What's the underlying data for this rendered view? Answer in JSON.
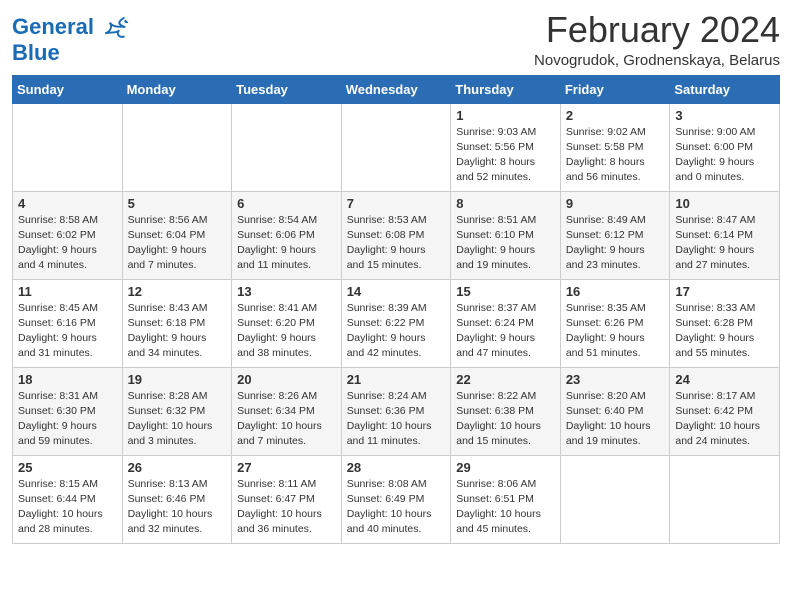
{
  "header": {
    "logo_line1": "General",
    "logo_line2": "Blue",
    "month_title": "February 2024",
    "subtitle": "Novogrudok, Grodnenskaya, Belarus"
  },
  "days_of_week": [
    "Sunday",
    "Monday",
    "Tuesday",
    "Wednesday",
    "Thursday",
    "Friday",
    "Saturday"
  ],
  "weeks": [
    [
      {
        "day": "",
        "info": ""
      },
      {
        "day": "",
        "info": ""
      },
      {
        "day": "",
        "info": ""
      },
      {
        "day": "",
        "info": ""
      },
      {
        "day": "1",
        "info": "Sunrise: 9:03 AM\nSunset: 5:56 PM\nDaylight: 8 hours\nand 52 minutes."
      },
      {
        "day": "2",
        "info": "Sunrise: 9:02 AM\nSunset: 5:58 PM\nDaylight: 8 hours\nand 56 minutes."
      },
      {
        "day": "3",
        "info": "Sunrise: 9:00 AM\nSunset: 6:00 PM\nDaylight: 9 hours\nand 0 minutes."
      }
    ],
    [
      {
        "day": "4",
        "info": "Sunrise: 8:58 AM\nSunset: 6:02 PM\nDaylight: 9 hours\nand 4 minutes."
      },
      {
        "day": "5",
        "info": "Sunrise: 8:56 AM\nSunset: 6:04 PM\nDaylight: 9 hours\nand 7 minutes."
      },
      {
        "day": "6",
        "info": "Sunrise: 8:54 AM\nSunset: 6:06 PM\nDaylight: 9 hours\nand 11 minutes."
      },
      {
        "day": "7",
        "info": "Sunrise: 8:53 AM\nSunset: 6:08 PM\nDaylight: 9 hours\nand 15 minutes."
      },
      {
        "day": "8",
        "info": "Sunrise: 8:51 AM\nSunset: 6:10 PM\nDaylight: 9 hours\nand 19 minutes."
      },
      {
        "day": "9",
        "info": "Sunrise: 8:49 AM\nSunset: 6:12 PM\nDaylight: 9 hours\nand 23 minutes."
      },
      {
        "day": "10",
        "info": "Sunrise: 8:47 AM\nSunset: 6:14 PM\nDaylight: 9 hours\nand 27 minutes."
      }
    ],
    [
      {
        "day": "11",
        "info": "Sunrise: 8:45 AM\nSunset: 6:16 PM\nDaylight: 9 hours\nand 31 minutes."
      },
      {
        "day": "12",
        "info": "Sunrise: 8:43 AM\nSunset: 6:18 PM\nDaylight: 9 hours\nand 34 minutes."
      },
      {
        "day": "13",
        "info": "Sunrise: 8:41 AM\nSunset: 6:20 PM\nDaylight: 9 hours\nand 38 minutes."
      },
      {
        "day": "14",
        "info": "Sunrise: 8:39 AM\nSunset: 6:22 PM\nDaylight: 9 hours\nand 42 minutes."
      },
      {
        "day": "15",
        "info": "Sunrise: 8:37 AM\nSunset: 6:24 PM\nDaylight: 9 hours\nand 47 minutes."
      },
      {
        "day": "16",
        "info": "Sunrise: 8:35 AM\nSunset: 6:26 PM\nDaylight: 9 hours\nand 51 minutes."
      },
      {
        "day": "17",
        "info": "Sunrise: 8:33 AM\nSunset: 6:28 PM\nDaylight: 9 hours\nand 55 minutes."
      }
    ],
    [
      {
        "day": "18",
        "info": "Sunrise: 8:31 AM\nSunset: 6:30 PM\nDaylight: 9 hours\nand 59 minutes."
      },
      {
        "day": "19",
        "info": "Sunrise: 8:28 AM\nSunset: 6:32 PM\nDaylight: 10 hours\nand 3 minutes."
      },
      {
        "day": "20",
        "info": "Sunrise: 8:26 AM\nSunset: 6:34 PM\nDaylight: 10 hours\nand 7 minutes."
      },
      {
        "day": "21",
        "info": "Sunrise: 8:24 AM\nSunset: 6:36 PM\nDaylight: 10 hours\nand 11 minutes."
      },
      {
        "day": "22",
        "info": "Sunrise: 8:22 AM\nSunset: 6:38 PM\nDaylight: 10 hours\nand 15 minutes."
      },
      {
        "day": "23",
        "info": "Sunrise: 8:20 AM\nSunset: 6:40 PM\nDaylight: 10 hours\nand 19 minutes."
      },
      {
        "day": "24",
        "info": "Sunrise: 8:17 AM\nSunset: 6:42 PM\nDaylight: 10 hours\nand 24 minutes."
      }
    ],
    [
      {
        "day": "25",
        "info": "Sunrise: 8:15 AM\nSunset: 6:44 PM\nDaylight: 10 hours\nand 28 minutes."
      },
      {
        "day": "26",
        "info": "Sunrise: 8:13 AM\nSunset: 6:46 PM\nDaylight: 10 hours\nand 32 minutes."
      },
      {
        "day": "27",
        "info": "Sunrise: 8:11 AM\nSunset: 6:47 PM\nDaylight: 10 hours\nand 36 minutes."
      },
      {
        "day": "28",
        "info": "Sunrise: 8:08 AM\nSunset: 6:49 PM\nDaylight: 10 hours\nand 40 minutes."
      },
      {
        "day": "29",
        "info": "Sunrise: 8:06 AM\nSunset: 6:51 PM\nDaylight: 10 hours\nand 45 minutes."
      },
      {
        "day": "",
        "info": ""
      },
      {
        "day": "",
        "info": ""
      }
    ]
  ]
}
